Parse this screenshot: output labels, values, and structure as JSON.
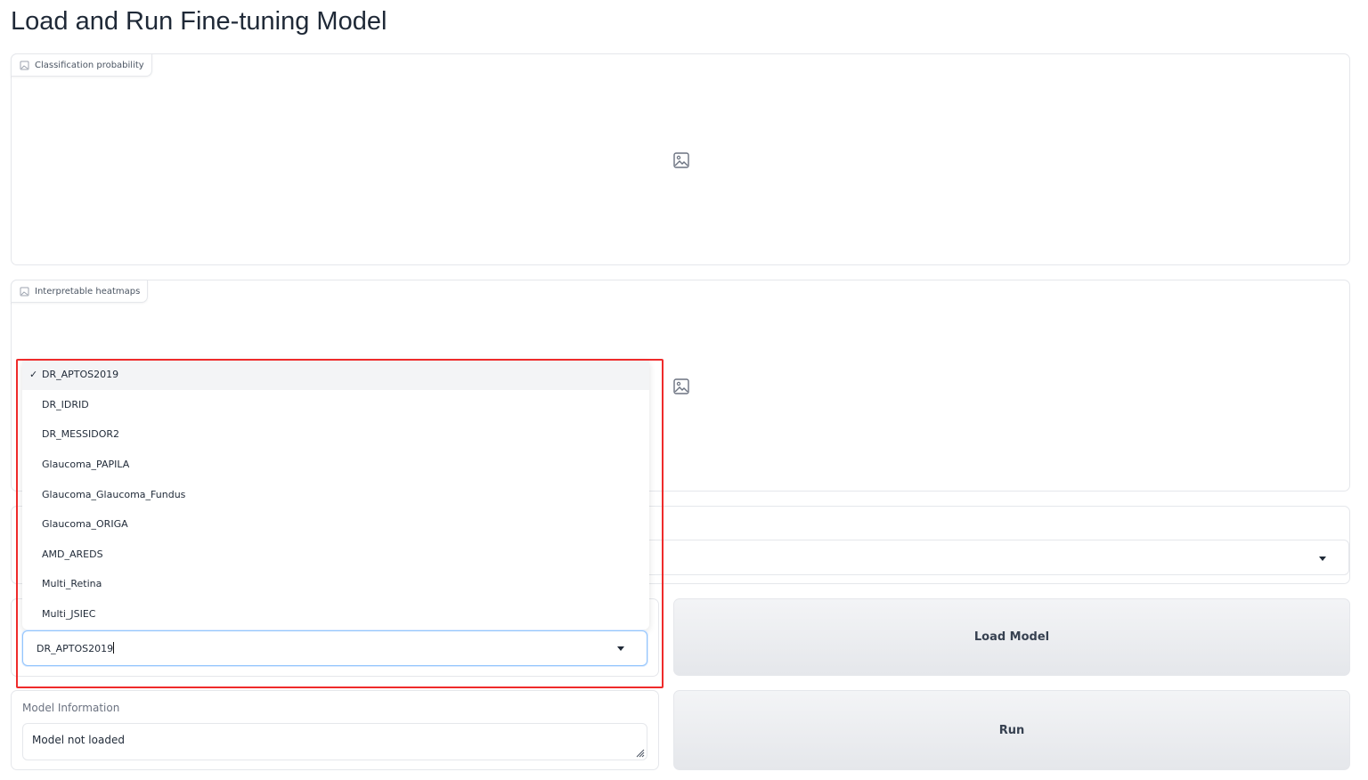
{
  "page": {
    "title": "Load and Run Fine-tuning Model"
  },
  "classification_panel": {
    "label": "Classification probability"
  },
  "heatmap_panel": {
    "label": "Interpretable heatmaps"
  },
  "model_dropdown": {
    "selected_value": "DR_APTOS2019",
    "options": [
      "DR_APTOS2019",
      "DR_IDRID",
      "DR_MESSIDOR2",
      "Glaucoma_PAPILA",
      "Glaucoma_Glaucoma_Fundus",
      "Glaucoma_ORIGA",
      "AMD_AREDS",
      "Multi_Retina",
      "Multi_JSIEC"
    ],
    "check_mark": "✓"
  },
  "buttons": {
    "load_model": "Load Model",
    "run": "Run"
  },
  "model_info": {
    "label": "Model Information",
    "value": "Model not loaded"
  },
  "colors": {
    "highlight": "#ef2b2b",
    "focus_border": "#93c5fd",
    "button_bg": "#e5e7eb"
  },
  "icons": {
    "placeholder": "image-icon",
    "dropdown": "caret-down-icon",
    "resize": "resize-grip-icon"
  }
}
